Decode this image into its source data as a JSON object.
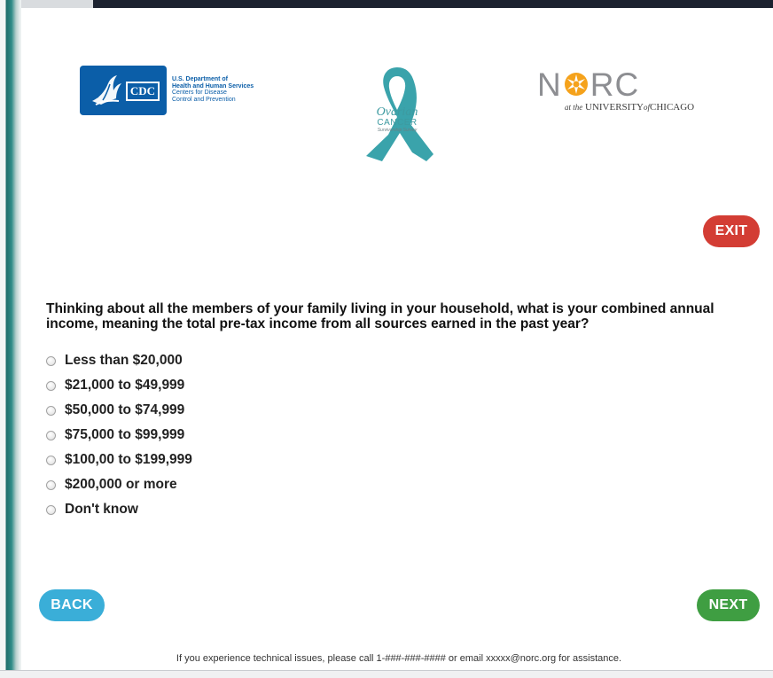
{
  "logos": {
    "cdc": {
      "mark": "CDC",
      "hhs_lines": [
        "U.S. Department of",
        "Health and Human Services",
        "Centers for Disease",
        "Control and Prevention"
      ]
    },
    "ribbon": {
      "line1": "Ovarian",
      "line2": "CANCER",
      "line3": "Survivorship Survey",
      "color": "#3aa3ab"
    },
    "norc": {
      "part1": "N",
      "part2": "RC",
      "sub_prefix": "at the",
      "sub_main": "UNIVERSITY",
      "sub_of": "of",
      "sub_end": "CHICAGO",
      "star_color": "#f5a21b"
    }
  },
  "buttons": {
    "exit": "EXIT",
    "back": "BACK",
    "next": "NEXT"
  },
  "question": "Thinking about all the members of your family living in your household, what is your combined annual income, meaning the total pre-tax income from all sources earned in the past year?",
  "options": [
    "Less than $20,000",
    "$21,000 to $49,999",
    "$50,000 to $74,999",
    "$75,000 to $99,999",
    "$100,00 to $199,999",
    "$200,000 or more",
    "Don't know"
  ],
  "footer": "If you experience technical issues, please call 1-###-###-#### or email xxxxx@norc.org for assistance.",
  "colors": {
    "exit": "#d33d34",
    "back": "#3aaed8",
    "next": "#3f9e42",
    "cdc_blue": "#0b5ea8"
  }
}
